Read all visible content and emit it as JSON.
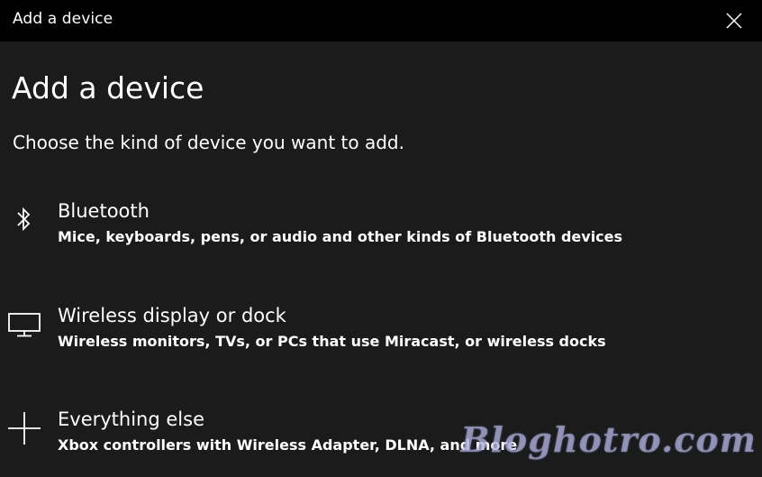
{
  "window": {
    "title": "Add a device"
  },
  "page": {
    "heading": "Add a device",
    "subtitle": "Choose the kind of device you want to add."
  },
  "options": [
    {
      "icon": "bluetooth-icon",
      "title": "Bluetooth",
      "description": "Mice, keyboards, pens, or audio and other kinds of Bluetooth devices"
    },
    {
      "icon": "monitor-icon",
      "title": "Wireless display or dock",
      "description": "Wireless monitors, TVs, or PCs that use Miracast, or wireless docks"
    },
    {
      "icon": "plus-icon",
      "title": "Everything else",
      "description": "Xbox controllers with Wireless Adapter, DLNA, and more"
    }
  ],
  "watermark": "Bloghotro.com",
  "colors": {
    "background": "#1b1b1b",
    "titlebar": "#000000",
    "text": "#ffffff"
  }
}
